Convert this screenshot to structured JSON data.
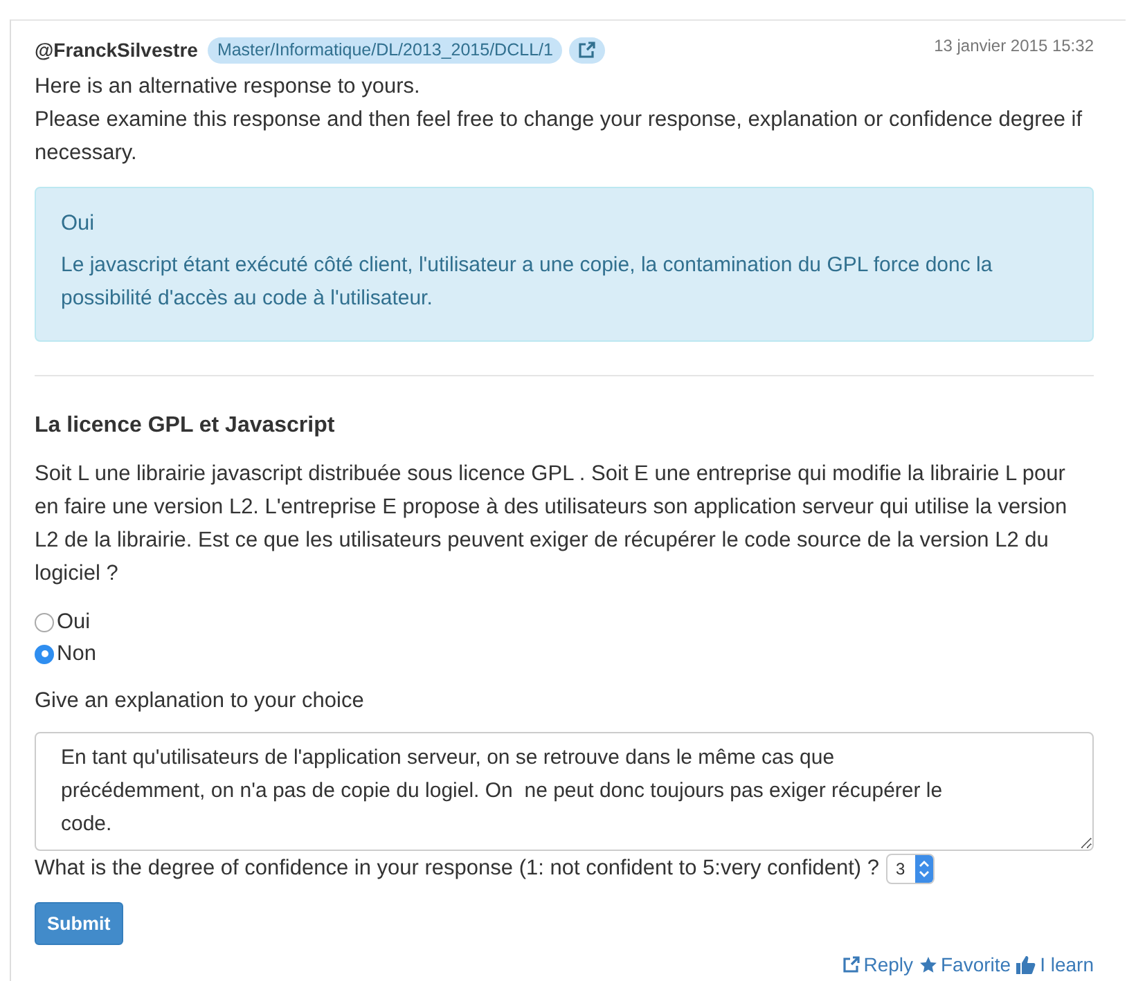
{
  "post": {
    "author": "@FranckSilvestre",
    "tag": "Master/Informatique/DL/2013_2015/DCLL/1",
    "date": "13 janvier 2015 15:32"
  },
  "intro": [
    "Here is an alternative response to yours.",
    "Please examine this response and then feel free to change your response, explanation or confidence degree if necessary."
  ],
  "alternative": {
    "answer": "Oui",
    "explanation": "Le javascript étant exécuté côté client, l'utilisateur a une copie, la contamination du GPL force donc la possibilité d'accès au code à l'utilisateur."
  },
  "question": {
    "title": "La licence GPL et Javascript",
    "text": "Soit L une librairie javascript distribuée sous licence GPL . Soit E une entreprise qui modifie la librairie L pour en faire une version L2. L'entreprise E propose à des utilisateurs son application serveur qui utilise la version L2 de la librairie. Est ce que les utilisateurs peuvent exiger de récupérer le code source de la version L2 du logiciel ?"
  },
  "options": [
    {
      "label": "Oui",
      "selected": false
    },
    {
      "label": "Non",
      "selected": true
    }
  ],
  "explanation_label": "Give an explanation to your choice",
  "explanation_value": "En tant qu'utilisateurs de l'application serveur, on se retrouve dans le même cas que précédemment, on n'a pas de copie du logiel. On  ne peut donc toujours pas exiger récupérer le code.",
  "confidence": {
    "label": "What is the degree of confidence in your response (1: not confident to 5:very confident) ?",
    "value": "3"
  },
  "submit": "Submit",
  "actions": [
    {
      "kind": "reply",
      "label": "Reply"
    },
    {
      "kind": "favorite",
      "label": "Favorite"
    },
    {
      "kind": "learn",
      "label": "I learn"
    }
  ]
}
